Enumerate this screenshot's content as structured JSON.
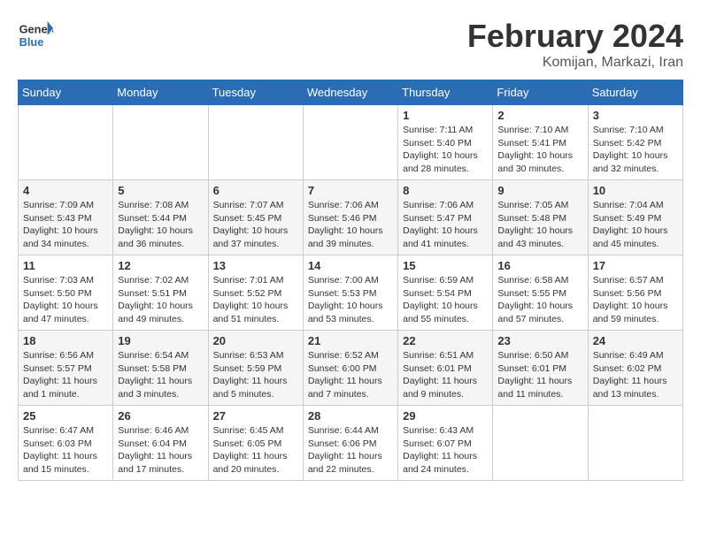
{
  "header": {
    "logo_general": "General",
    "logo_blue": "Blue",
    "month_title": "February 2024",
    "subtitle": "Komijan, Markazi, Iran"
  },
  "weekdays": [
    "Sunday",
    "Monday",
    "Tuesday",
    "Wednesday",
    "Thursday",
    "Friday",
    "Saturday"
  ],
  "weeks": [
    [
      null,
      null,
      null,
      null,
      {
        "day": 1,
        "sunrise": "7:11 AM",
        "sunset": "5:40 PM",
        "daylight": "10 hours and 28 minutes."
      },
      {
        "day": 2,
        "sunrise": "7:10 AM",
        "sunset": "5:41 PM",
        "daylight": "10 hours and 30 minutes."
      },
      {
        "day": 3,
        "sunrise": "7:10 AM",
        "sunset": "5:42 PM",
        "daylight": "10 hours and 32 minutes."
      }
    ],
    [
      {
        "day": 4,
        "sunrise": "7:09 AM",
        "sunset": "5:43 PM",
        "daylight": "10 hours and 34 minutes."
      },
      {
        "day": 5,
        "sunrise": "7:08 AM",
        "sunset": "5:44 PM",
        "daylight": "10 hours and 36 minutes."
      },
      {
        "day": 6,
        "sunrise": "7:07 AM",
        "sunset": "5:45 PM",
        "daylight": "10 hours and 37 minutes."
      },
      {
        "day": 7,
        "sunrise": "7:06 AM",
        "sunset": "5:46 PM",
        "daylight": "10 hours and 39 minutes."
      },
      {
        "day": 8,
        "sunrise": "7:06 AM",
        "sunset": "5:47 PM",
        "daylight": "10 hours and 41 minutes."
      },
      {
        "day": 9,
        "sunrise": "7:05 AM",
        "sunset": "5:48 PM",
        "daylight": "10 hours and 43 minutes."
      },
      {
        "day": 10,
        "sunrise": "7:04 AM",
        "sunset": "5:49 PM",
        "daylight": "10 hours and 45 minutes."
      }
    ],
    [
      {
        "day": 11,
        "sunrise": "7:03 AM",
        "sunset": "5:50 PM",
        "daylight": "10 hours and 47 minutes."
      },
      {
        "day": 12,
        "sunrise": "7:02 AM",
        "sunset": "5:51 PM",
        "daylight": "10 hours and 49 minutes."
      },
      {
        "day": 13,
        "sunrise": "7:01 AM",
        "sunset": "5:52 PM",
        "daylight": "10 hours and 51 minutes."
      },
      {
        "day": 14,
        "sunrise": "7:00 AM",
        "sunset": "5:53 PM",
        "daylight": "10 hours and 53 minutes."
      },
      {
        "day": 15,
        "sunrise": "6:59 AM",
        "sunset": "5:54 PM",
        "daylight": "10 hours and 55 minutes."
      },
      {
        "day": 16,
        "sunrise": "6:58 AM",
        "sunset": "5:55 PM",
        "daylight": "10 hours and 57 minutes."
      },
      {
        "day": 17,
        "sunrise": "6:57 AM",
        "sunset": "5:56 PM",
        "daylight": "10 hours and 59 minutes."
      }
    ],
    [
      {
        "day": 18,
        "sunrise": "6:56 AM",
        "sunset": "5:57 PM",
        "daylight": "11 hours and 1 minute."
      },
      {
        "day": 19,
        "sunrise": "6:54 AM",
        "sunset": "5:58 PM",
        "daylight": "11 hours and 3 minutes."
      },
      {
        "day": 20,
        "sunrise": "6:53 AM",
        "sunset": "5:59 PM",
        "daylight": "11 hours and 5 minutes."
      },
      {
        "day": 21,
        "sunrise": "6:52 AM",
        "sunset": "6:00 PM",
        "daylight": "11 hours and 7 minutes."
      },
      {
        "day": 22,
        "sunrise": "6:51 AM",
        "sunset": "6:01 PM",
        "daylight": "11 hours and 9 minutes."
      },
      {
        "day": 23,
        "sunrise": "6:50 AM",
        "sunset": "6:01 PM",
        "daylight": "11 hours and 11 minutes."
      },
      {
        "day": 24,
        "sunrise": "6:49 AM",
        "sunset": "6:02 PM",
        "daylight": "11 hours and 13 minutes."
      }
    ],
    [
      {
        "day": 25,
        "sunrise": "6:47 AM",
        "sunset": "6:03 PM",
        "daylight": "11 hours and 15 minutes."
      },
      {
        "day": 26,
        "sunrise": "6:46 AM",
        "sunset": "6:04 PM",
        "daylight": "11 hours and 17 minutes."
      },
      {
        "day": 27,
        "sunrise": "6:45 AM",
        "sunset": "6:05 PM",
        "daylight": "11 hours and 20 minutes."
      },
      {
        "day": 28,
        "sunrise": "6:44 AM",
        "sunset": "6:06 PM",
        "daylight": "11 hours and 22 minutes."
      },
      {
        "day": 29,
        "sunrise": "6:43 AM",
        "sunset": "6:07 PM",
        "daylight": "11 hours and 24 minutes."
      },
      null,
      null
    ]
  ]
}
